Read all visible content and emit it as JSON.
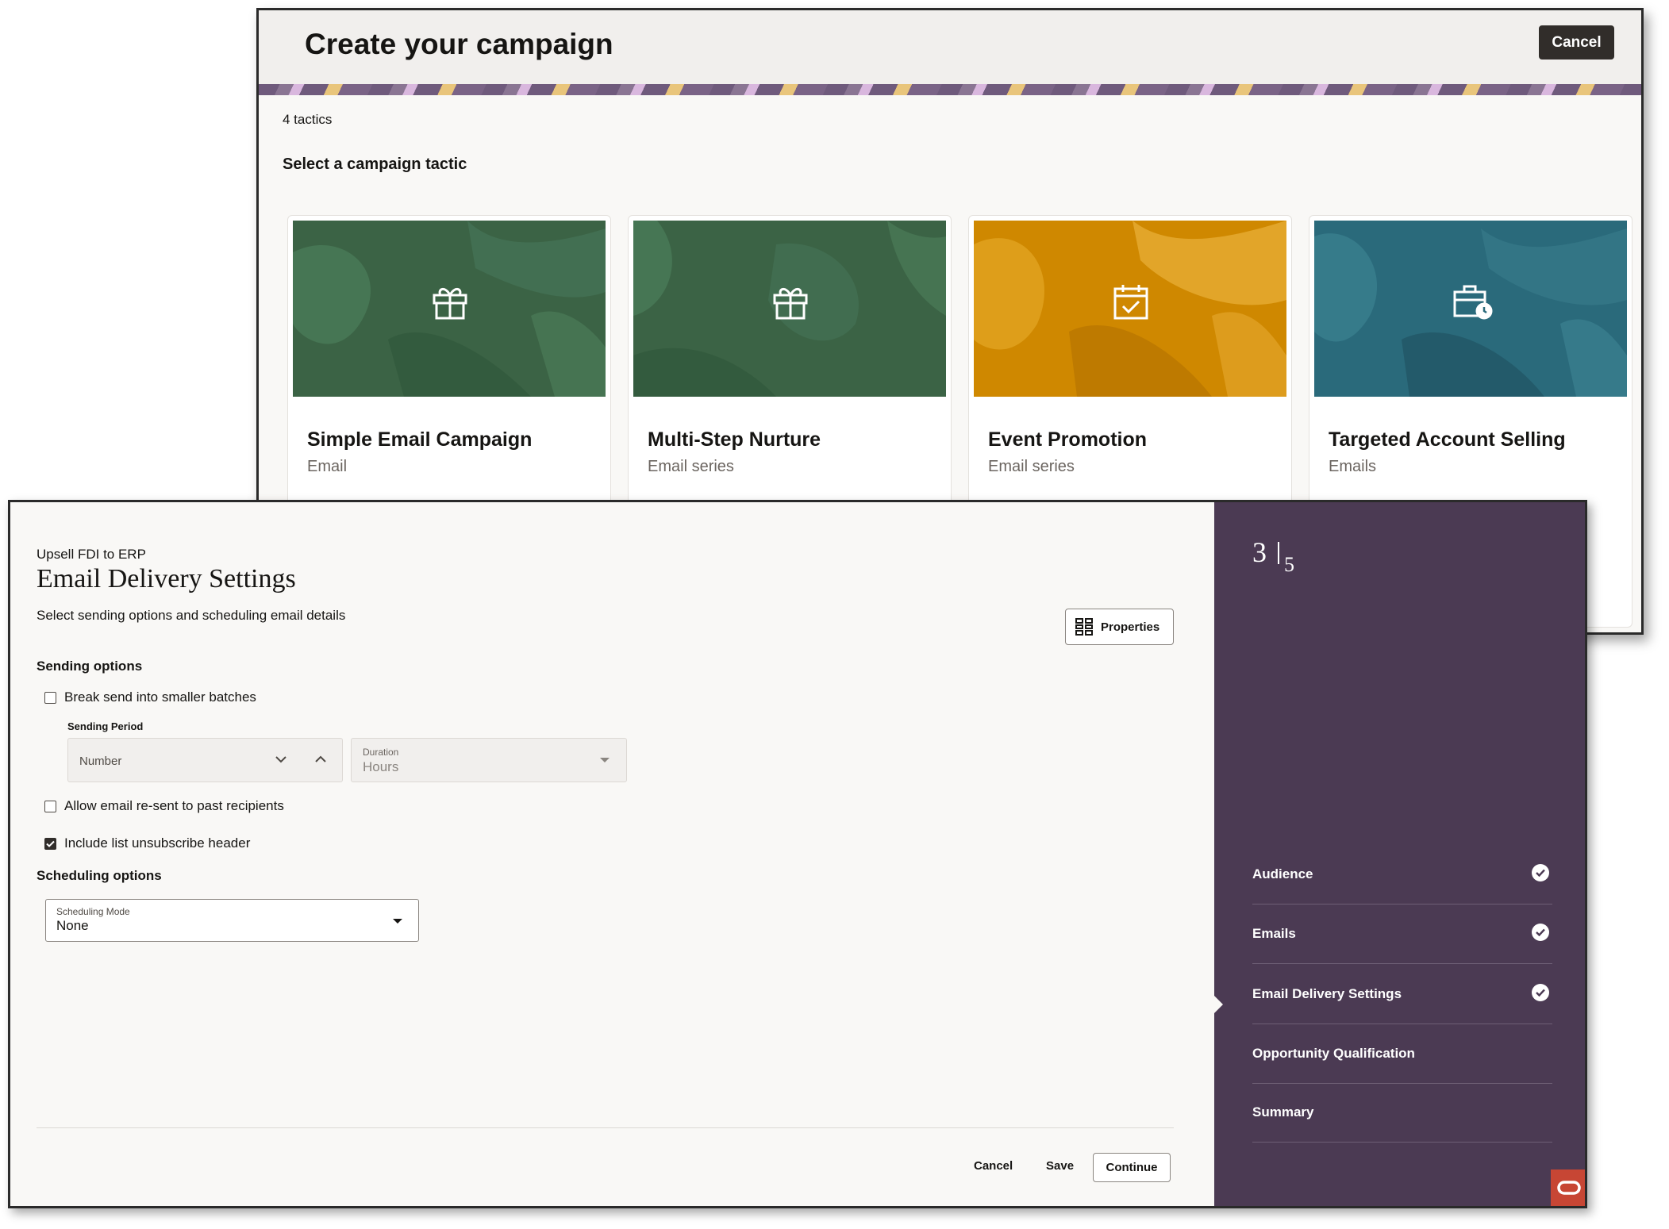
{
  "campaign": {
    "title": "Create your campaign",
    "cancel_label": "Cancel",
    "tactics_count": "4 tactics",
    "select_heading": "Select a campaign tactic",
    "cards": [
      {
        "title": "Simple Email Campaign",
        "subtitle": "Email",
        "icon": "gift-icon",
        "color": "#3d6b4a"
      },
      {
        "title": "Multi-Step Nurture",
        "subtitle": "Email series",
        "icon": "gift-icon",
        "color": "#3d6b4a"
      },
      {
        "title": "Event Promotion",
        "subtitle": "Email series",
        "icon": "calendar-check-icon",
        "color": "#d08a00"
      },
      {
        "title": "Targeted Account Selling",
        "subtitle": "Emails",
        "icon": "briefcase-clock-icon",
        "color": "#2b6c7e"
      }
    ]
  },
  "settings": {
    "breadcrumb": "Upsell FDI to ERP",
    "title": "Email Delivery Settings",
    "description": "Select sending options and scheduling email details",
    "properties_label": "Properties",
    "sending_heading": "Sending options",
    "break_send_label": "Break send into smaller batches",
    "sending_period_label": "Sending Period",
    "number_placeholder": "Number",
    "duration_label": "Duration",
    "duration_value": "Hours",
    "resend_label": "Allow email re-sent to past recipients",
    "unsubscribe_label": "Include list unsubscribe header",
    "checkboxes": {
      "break_send": false,
      "resend": false,
      "unsubscribe": true
    },
    "scheduling_heading": "Scheduling options",
    "scheduling_mode_label": "Scheduling Mode",
    "scheduling_mode_value": "None",
    "footer": {
      "cancel": "Cancel",
      "save": "Save",
      "continue": "Continue"
    }
  },
  "progress": {
    "current": "3",
    "total": "5",
    "steps": [
      {
        "label": "Audience",
        "done": true
      },
      {
        "label": "Emails",
        "done": true
      },
      {
        "label": "Email Delivery Settings",
        "done": true
      },
      {
        "label": "Opportunity Qualification",
        "done": false
      },
      {
        "label": "Summary",
        "done": false
      }
    ]
  },
  "colors": {
    "panel": "#4b3a53",
    "dark_button": "#312d2a",
    "oracle_red": "#c74634"
  }
}
